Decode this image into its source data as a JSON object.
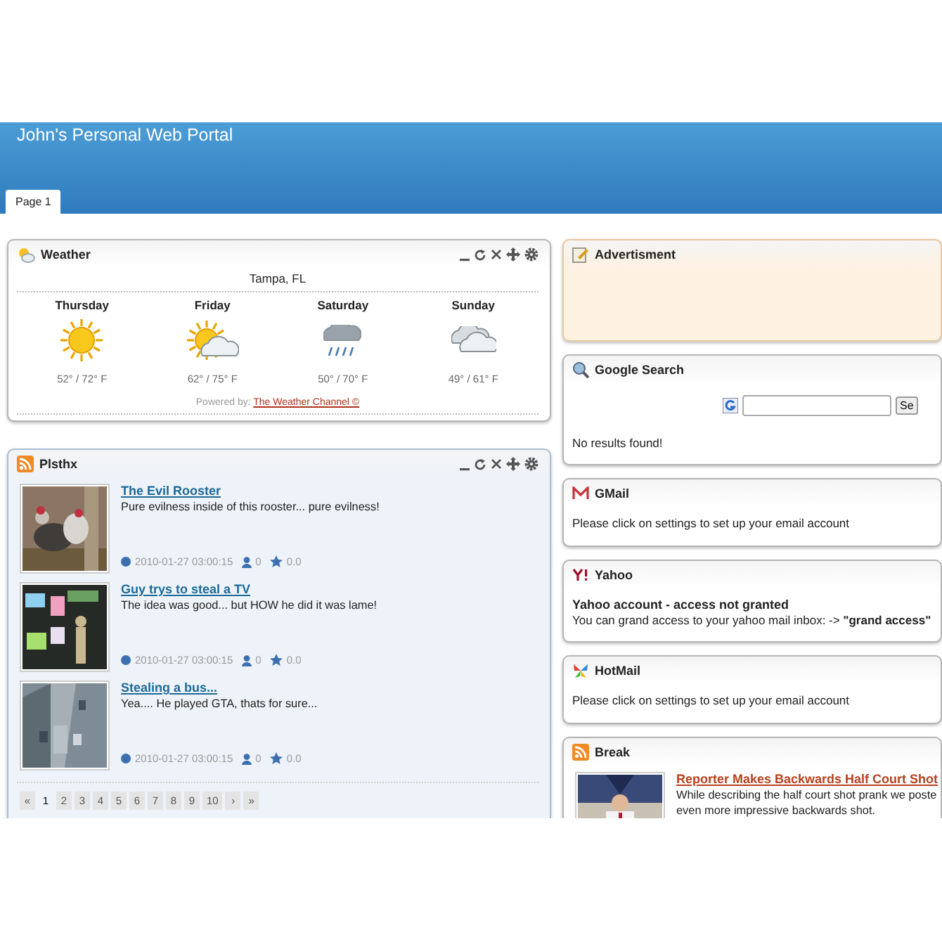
{
  "header": {
    "title": "John's Personal Web Portal"
  },
  "tabs": [
    {
      "label": "Page 1",
      "selected": true
    }
  ],
  "columns": [
    {
      "widgets": [
        {
          "kind": "weather",
          "title": "Weather",
          "controls": true,
          "color": "#ffffff",
          "location": "Tampa, FL",
          "days": [
            {
              "day": "Thursday",
              "kind": "sunny",
              "temps": "52° / 72° F"
            },
            {
              "day": "Friday",
              "kind": "partly",
              "temps": "62° / 75° F"
            },
            {
              "day": "Saturday",
              "kind": "rain",
              "temps": "50° / 70° F"
            },
            {
              "day": "Sunday",
              "kind": "cloudy",
              "temps": "49° / 61° F"
            }
          ],
          "credit_label": "Powered by:",
          "credit_link": "The Weather Channel ©"
        },
        {
          "kind": "feed",
          "title": "Plsthx",
          "controls": true,
          "color": "#eef3f9",
          "items": [
            {
              "color": "#1d6a98",
              "title": "The Evil Rooster",
              "text": "Pure evilness inside of this rooster... pure evilness!",
              "date": "2010-01-27 03:00:15",
              "views": "0",
              "rating": "0.0"
            },
            {
              "color": "#1d6a98",
              "title": "Guy trys to steal a TV",
              "text": "The idea was good... but HOW he did it was lame!",
              "date": "2010-01-27 03:00:15",
              "views": "0",
              "rating": "0.0"
            },
            {
              "color": "#1d6a98",
              "title": "Stealing a bus...",
              "text": "Yea.... He played GTA, thats for sure...",
              "date": "2010-01-27 03:00:15",
              "views": "0",
              "rating": "0.0"
            }
          ],
          "pages": [
            {
              "label": "«",
              "selected": false
            },
            {
              "label": "1",
              "selected": true
            },
            {
              "label": "2",
              "selected": false
            },
            {
              "label": "3",
              "selected": false
            },
            {
              "label": "4",
              "selected": false
            },
            {
              "label": "5",
              "selected": false
            },
            {
              "label": "6",
              "selected": false
            },
            {
              "label": "7",
              "selected": false
            },
            {
              "label": "8",
              "selected": false
            },
            {
              "label": "9",
              "selected": false
            },
            {
              "label": "10",
              "selected": false
            },
            {
              "label": "›",
              "selected": false
            },
            {
              "label": "»",
              "selected": false
            }
          ]
        }
      ]
    },
    {
      "widgets": [
        {
          "kind": "ad",
          "title": "Advertisment",
          "controls": false,
          "color": "#fdf1e2"
        },
        {
          "kind": "search",
          "title": "Google Search",
          "controls": false,
          "color": "#ffffff",
          "button": "Se",
          "message": "No results found!"
        },
        {
          "kind": "gmail",
          "title": "GMail",
          "controls": false,
          "color": "#ffffff",
          "message": "Please click on settings to set up your email account"
        },
        {
          "kind": "yahoo",
          "title": "Yahoo",
          "controls": false,
          "color": "#ffffff",
          "heading": "Yahoo account - access not granted",
          "message": "You can grand access to your yahoo mail inbox: -> **\"grand access\"**"
        },
        {
          "kind": "hotmail",
          "title": "HotMail",
          "controls": false,
          "color": "#ffffff",
          "message": "Please click on settings to set up your email account"
        },
        {
          "kind": "feed",
          "title": "Break",
          "controls": false,
          "color": "#ffffff",
          "items": [
            {
              "color": "#b8401e",
              "title": "Reporter Makes Backwards Half Court Shot",
              "text": "While describing the half court shot prank we poste\neven more impressive backwards shot."
            }
          ]
        }
      ]
    }
  ]
}
